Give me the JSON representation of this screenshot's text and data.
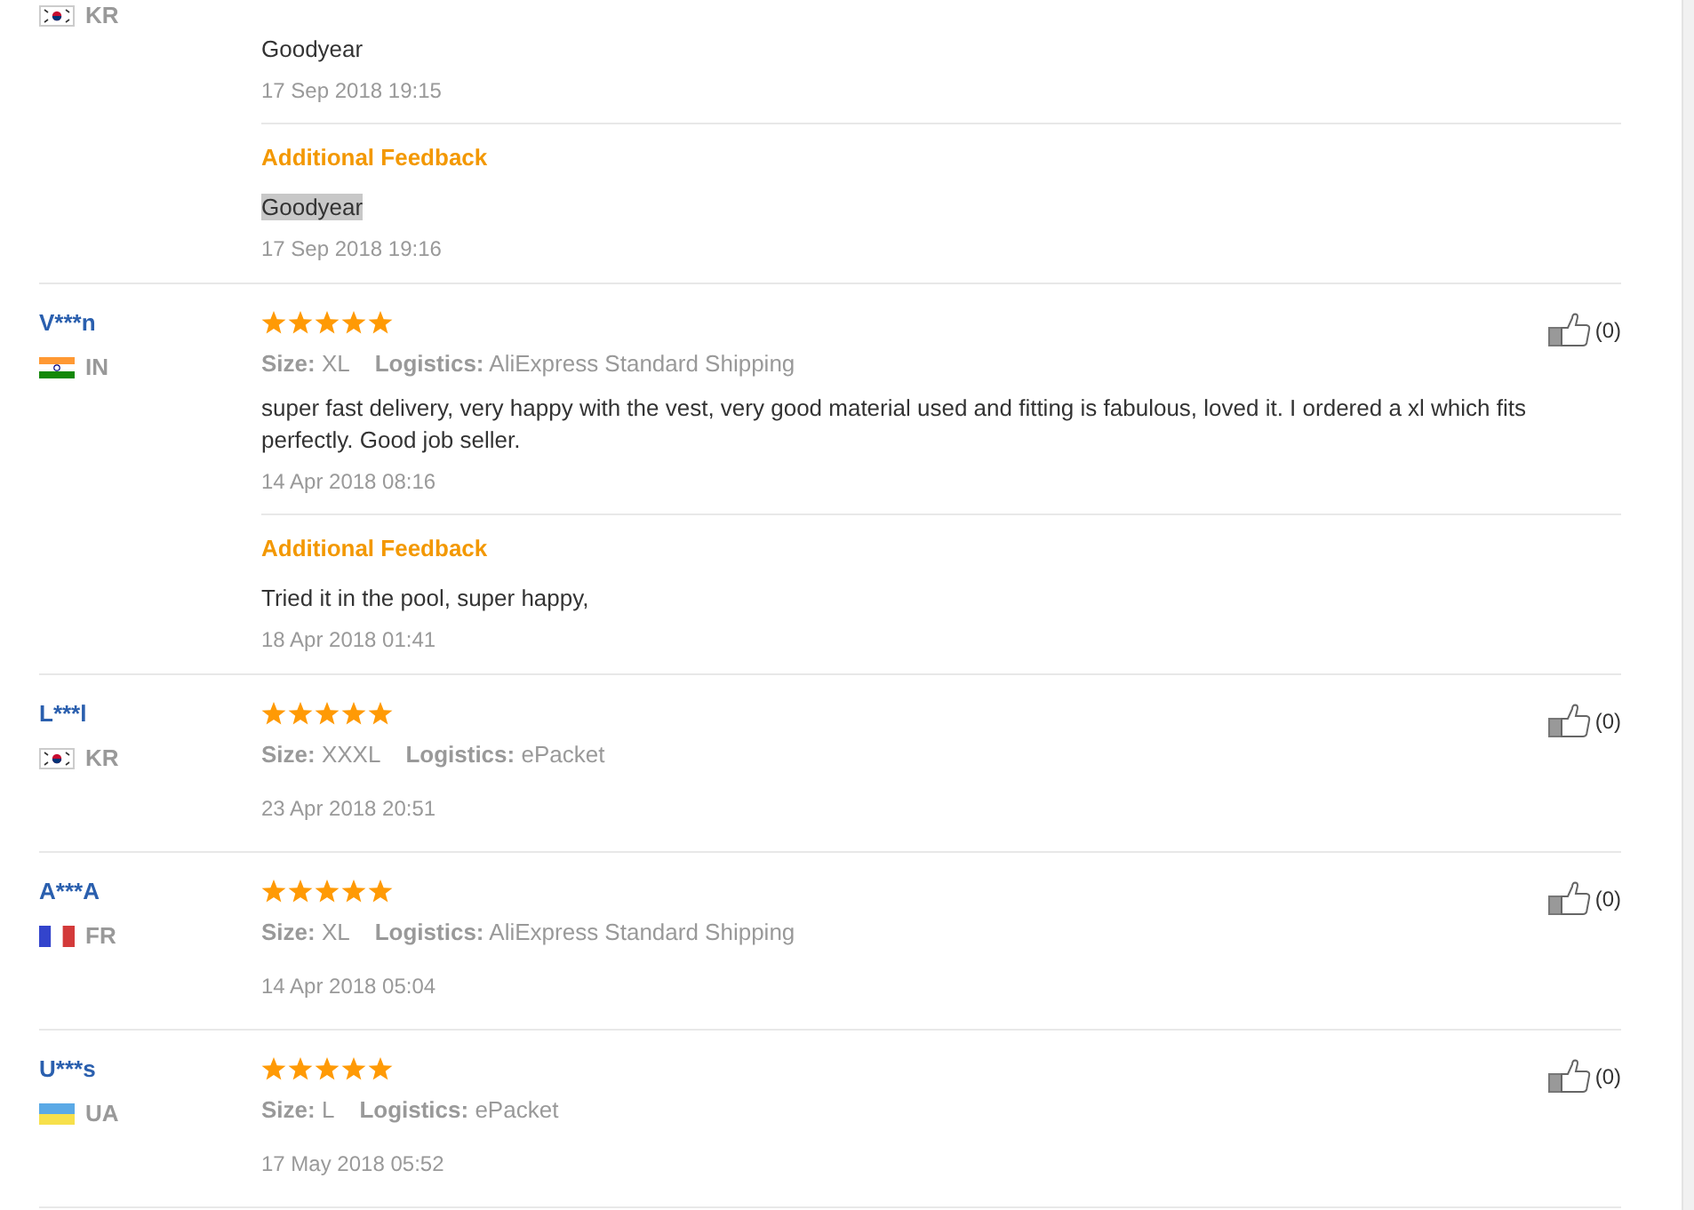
{
  "reviews": [
    {
      "country": "KR",
      "flag": {
        "kind": "korea"
      },
      "text": "Goodyear",
      "date": "17 Sep 2018 19:15",
      "additional": {
        "heading": "Additional Feedback",
        "text": "Goodyear",
        "highlighted": true,
        "date": "17 Sep 2018 19:16"
      }
    },
    {
      "user": "V***n",
      "country": "IN",
      "flag": {
        "kind": "india"
      },
      "stars": 5,
      "helpful": "(0)",
      "size": {
        "label": "Size:",
        "value": "XL"
      },
      "logistics": {
        "label": "Logistics:",
        "value": "AliExpress Standard Shipping"
      },
      "text": "super fast delivery, very happy with the vest, very good material used and fitting is fabulous, loved it. I ordered a xl which fits perfectly. Good job seller.",
      "date": "14 Apr 2018 08:16",
      "additional": {
        "heading": "Additional Feedback",
        "text": "Tried it in the pool, super happy,",
        "highlighted": false,
        "date": "18 Apr 2018 01:41"
      }
    },
    {
      "user": "L***l",
      "country": "KR",
      "flag": {
        "kind": "korea"
      },
      "stars": 5,
      "helpful": "(0)",
      "size": {
        "label": "Size:",
        "value": "XXXL"
      },
      "logistics": {
        "label": "Logistics:",
        "value": "ePacket"
      },
      "date": "23 Apr 2018 20:51"
    },
    {
      "user": "A***A",
      "country": "FR",
      "flag": {
        "kind": "france"
      },
      "stars": 5,
      "helpful": "(0)",
      "size": {
        "label": "Size:",
        "value": "XL"
      },
      "logistics": {
        "label": "Logistics:",
        "value": "AliExpress Standard Shipping"
      },
      "date": "14 Apr 2018 05:04"
    },
    {
      "user": "U***s",
      "country": "UA",
      "flag": {
        "kind": "ukraine"
      },
      "stars": 5,
      "helpful": "(0)",
      "size": {
        "label": "Size:",
        "value": "L"
      },
      "logistics": {
        "label": "Logistics:",
        "value": "ePacket"
      },
      "date": "17 May 2018 05:52"
    }
  ]
}
